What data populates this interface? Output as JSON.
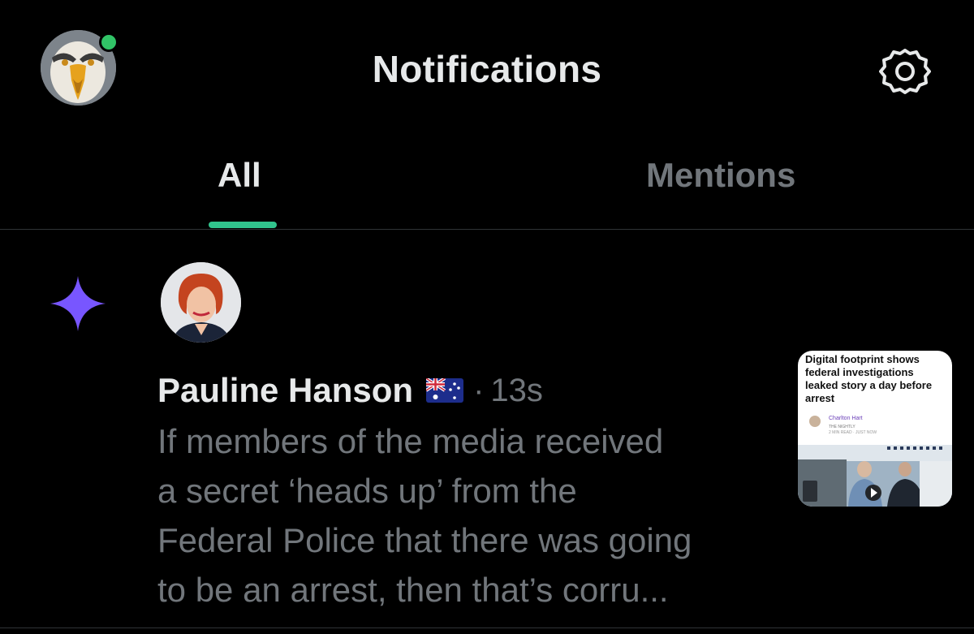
{
  "header": {
    "title": "Notifications",
    "profile_avatar_icon": "eagle-avatar",
    "settings_icon": "gear-icon",
    "online_status_color": "#31c467"
  },
  "tabs": [
    {
      "label": "All",
      "active": true
    },
    {
      "label": "Mentions",
      "active": false
    }
  ],
  "accent_color": "#31c48d",
  "notification": {
    "type_icon": "sparkle-icon",
    "type_icon_color": "#7856ff",
    "author_name": "Pauline Hanson",
    "author_flag": "australian-flag-icon",
    "separator": "·",
    "time": "13s",
    "text_lines": [
      "If members of the media received",
      "a secret ‘heads up’ from the",
      "Federal Police that there was going",
      "to be an arrest, then that’s corru..."
    ],
    "thumbnail": {
      "headline": "Digital footprint shows federal investigations leaked story a day before arrest",
      "author": "Charlton Hart",
      "publication": "THE NIGHTLY",
      "meta": "2 MIN READ · JUST NOW"
    }
  }
}
